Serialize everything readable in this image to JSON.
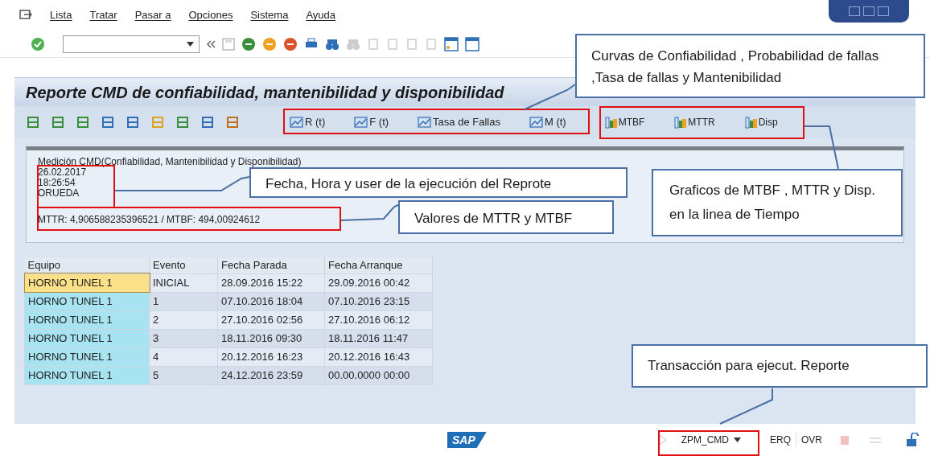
{
  "menu": [
    {
      "label": "Lista"
    },
    {
      "label": "Tratar"
    },
    {
      "label": "Pasar a"
    },
    {
      "label": "Opciones"
    },
    {
      "label": "Sistema"
    },
    {
      "label": "Ayuda"
    }
  ],
  "title": "Reporte CMD de confiabilidad, mantenibilidad y disponibilidad",
  "app_toolbar": {
    "curve_buttons": [
      {
        "label": "R (t)"
      },
      {
        "label": "F (t)"
      },
      {
        "label": "Tasa de Fallas"
      },
      {
        "label": "M (t)"
      }
    ],
    "chart_buttons": [
      {
        "label": "MTBF"
      },
      {
        "label": "MTTR"
      },
      {
        "label": "Disp"
      }
    ]
  },
  "header": {
    "lines": [
      "Medición CMD(Confiabilidad, Mantenibilidad y Disponibilidad)",
      "26.02.2017",
      "18:26:54",
      "ORUEDA",
      "MTTR: 4,906588235396521 / MTBF: 494,00924612"
    ]
  },
  "table": {
    "columns": [
      "Equipo",
      "Evento",
      "Fecha Parada",
      "Fecha Arranque"
    ],
    "rows": [
      {
        "cells": [
          "HORNO TUNEL 1",
          "INICIAL",
          "28.09.2016 15:22",
          "29.09.2016 00:42"
        ],
        "selected": true
      },
      {
        "cells": [
          "HORNO TUNEL 1",
          "1",
          "07.10.2016 18:04",
          "07.10.2016 23:15"
        ],
        "selected": false
      },
      {
        "cells": [
          "HORNO TUNEL 1",
          "2",
          "27.10.2016 02:56",
          "27.10.2016 06:12"
        ],
        "selected": false
      },
      {
        "cells": [
          "HORNO TUNEL 1",
          "3",
          "18.11.2016 09:30",
          "18.11.2016 11:47"
        ],
        "selected": false
      },
      {
        "cells": [
          "HORNO TUNEL 1",
          "4",
          "20.12.2016 16:23",
          "20.12.2016 16:43"
        ],
        "selected": false
      },
      {
        "cells": [
          "HORNO TUNEL 1",
          "5",
          "24.12.2016 23:59",
          "00.00.0000 00:00"
        ],
        "selected": false
      }
    ]
  },
  "status_bar": {
    "logo": "SAP",
    "transaction": "ZPM_CMD",
    "mode": "ERQ",
    "insert_mode": "OVR"
  },
  "callouts": [
    {
      "text": "Curvas de Confiabilidad , Probabilidad de fallas ,Tasa de fallas y Mantenibilidad"
    },
    {
      "text": "Fecha, Hora y user de la ejecución del Reprote"
    },
    {
      "text": "Valores de MTTR y MTBF"
    },
    {
      "text": "Graficos de MTBF , MTTR y Disp. en la linea de Tiempo"
    },
    {
      "text": "Transacción para ejecut. Reporte"
    }
  ]
}
